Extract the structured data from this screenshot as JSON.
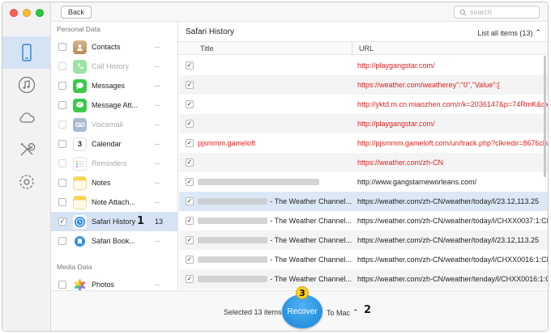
{
  "toolbar": {
    "back_label": "Back",
    "search_placeholder": "search"
  },
  "categories": {
    "personal_header": "Personal Data",
    "media_header": "Media Data",
    "items": [
      {
        "label": "Contacts",
        "count": "--",
        "icon": "contacts-icon",
        "dim": false,
        "checked": false
      },
      {
        "label": "Call History",
        "count": "--",
        "icon": "phone-icon",
        "dim": true,
        "checked": false
      },
      {
        "label": "Messages",
        "count": "--",
        "icon": "messages-icon",
        "dim": false,
        "checked": false
      },
      {
        "label": "Message Att...",
        "count": "--",
        "icon": "message-attachment-icon",
        "dim": false,
        "checked": false
      },
      {
        "label": "Voicemail",
        "count": "--",
        "icon": "voicemail-icon",
        "dim": true,
        "checked": false
      },
      {
        "label": "Calendar",
        "count": "--",
        "icon": "calendar-icon",
        "dim": false,
        "checked": false
      },
      {
        "label": "Reminders",
        "count": "--",
        "icon": "reminders-icon",
        "dim": true,
        "checked": false
      },
      {
        "label": "Notes",
        "count": "--",
        "icon": "notes-icon",
        "dim": false,
        "checked": false
      },
      {
        "label": "Note Attach...",
        "count": "--",
        "icon": "note-attachment-icon",
        "dim": false,
        "checked": false
      },
      {
        "label": "Safari History",
        "count": "13",
        "icon": "safari-history-icon",
        "dim": false,
        "checked": true,
        "selected": true
      },
      {
        "label": "Safari Book...",
        "count": "--",
        "icon": "safari-bookmarks-icon",
        "dim": false,
        "checked": false
      },
      {
        "label": "Photos",
        "count": "--",
        "icon": "photos-icon",
        "dim": false,
        "checked": false
      }
    ]
  },
  "main": {
    "title": "Safari History",
    "filter_label": "List all items (13)",
    "col_title": "Title",
    "col_url": "URL",
    "rows": [
      {
        "title": "",
        "url": "http://playgangstar.com/",
        "red": true,
        "blur": []
      },
      {
        "title": "",
        "url": "https://weather.com/weatherey\":\"0\",\"Value\":[",
        "red": true,
        "blur": []
      },
      {
        "title": "",
        "url": "http://yktd.m.cn.miaozhen.com/r/k=2036147&p=74RmK&dx=__",
        "red": true,
        "blur": []
      },
      {
        "title": "",
        "url": "http://playgangstar.com/",
        "red": true,
        "blur": []
      },
      {
        "title": "pjsmmm.gameloft",
        "url": "http://pjsmmm.gameloft.com/un/track.php?clkredir=8676clk6e",
        "red": true,
        "blur": []
      },
      {
        "title": "",
        "url": "https://weather.com/zh-CN",
        "red": true,
        "blur": []
      },
      {
        "title": "",
        "url": "http://www.gangstarneworleans.com/",
        "red": false,
        "blur": [
          150
        ]
      },
      {
        "title": "- The Weather Channel...",
        "url": "https://weather.com/zh-CN/weather/today/l/23.12,113.25",
        "red": false,
        "blur": [
          95
        ]
      },
      {
        "title": "- The Weather Channel...",
        "url": "https://weather.com/zh-CN/weather/today/l/CHXX0037:1:CH",
        "red": false,
        "blur": [
          95
        ]
      },
      {
        "title": "- The Weather Channel...",
        "url": "https://weather.com/zh-CN/weather/today/l/23.12,113.25",
        "red": false,
        "blur": [
          95
        ]
      },
      {
        "title": "- The Weather Channel...",
        "url": "https://weather.com/zh-CN/weather/today/l/CHXX0016:1:CH",
        "red": false,
        "blur": [
          95
        ]
      },
      {
        "title": "- The Weather Channel...",
        "url": "https://weather.com/zh-CN/weather/tenday/l/CHXX0016:1:CH",
        "red": false,
        "blur": [
          95
        ]
      }
    ]
  },
  "bottom": {
    "selected_label": "Selected 13 items",
    "recover_label": "Recover",
    "destination_label": "To Mac"
  },
  "markers": {
    "one": "1",
    "two": "2",
    "three": "3"
  },
  "colors": {
    "accent": "#1683d9",
    "deleted_text": "#e02020",
    "selection": "#d6e3f5"
  }
}
